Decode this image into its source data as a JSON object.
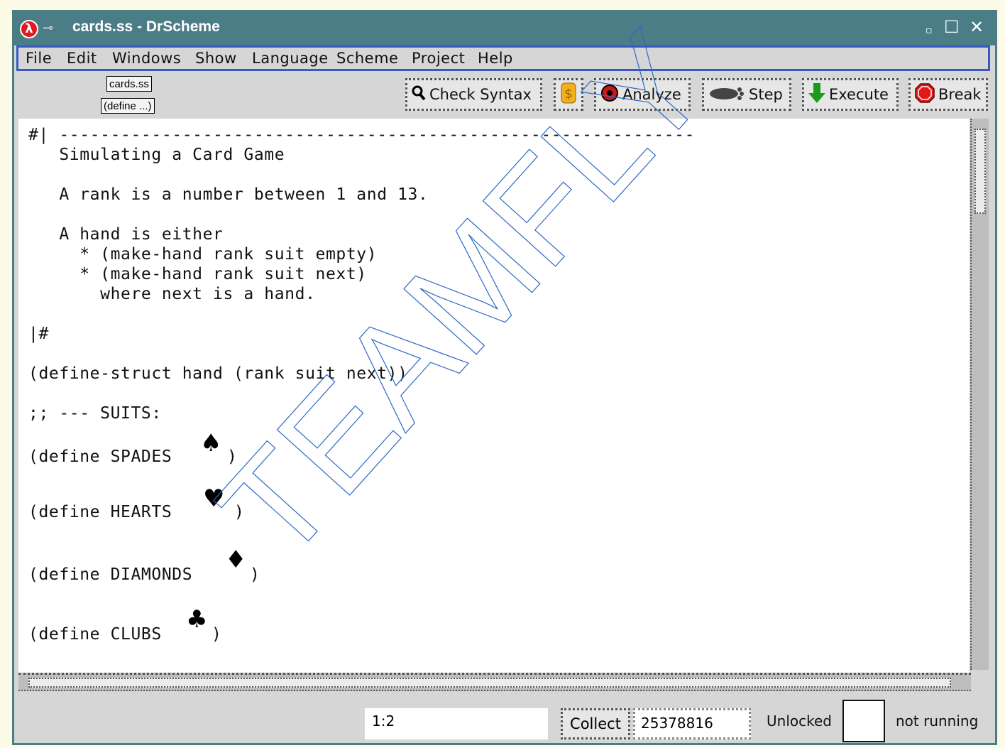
{
  "window": {
    "title": "cards.ss - DrScheme",
    "logo": "λ",
    "controls": [
      "▫",
      "☐",
      "✕"
    ]
  },
  "menu": [
    "File",
    "Edit",
    "Windows",
    "Show",
    "Language",
    "Scheme",
    "Project",
    "Help"
  ],
  "toolbar": {
    "file_label": "cards.ss",
    "define_label": "(define ...)",
    "check_syntax": "Check Syntax",
    "analyze": "Analyze",
    "step": "Step",
    "execute": "Execute",
    "break": "Break"
  },
  "editor": {
    "lines": [
      "#| --------------------------------------------------------------",
      "   Simulating a Card Game",
      "   A rank is a number between 1 and 13.",
      "   A hand is either",
      "     * (make-hand rank suit empty)",
      "     * (make-hand rank suit next)",
      "       where next is a hand.",
      "|#",
      "(define-struct hand (rank suit next))",
      ";; --- SUITS:",
      "(define SPADES",
      "(define HEARTS",
      "(define DIAMONDS",
      "(define CLUBS",
      ")"
    ],
    "suits": {
      "spades": "♠",
      "hearts": "♥",
      "diamonds": "♦",
      "clubs": "♣"
    }
  },
  "status": {
    "position": "1:2",
    "collect": "Collect",
    "memory": "25378816",
    "lock": "Unlocked",
    "running": "not running"
  },
  "watermark": "TEAMFLY"
}
